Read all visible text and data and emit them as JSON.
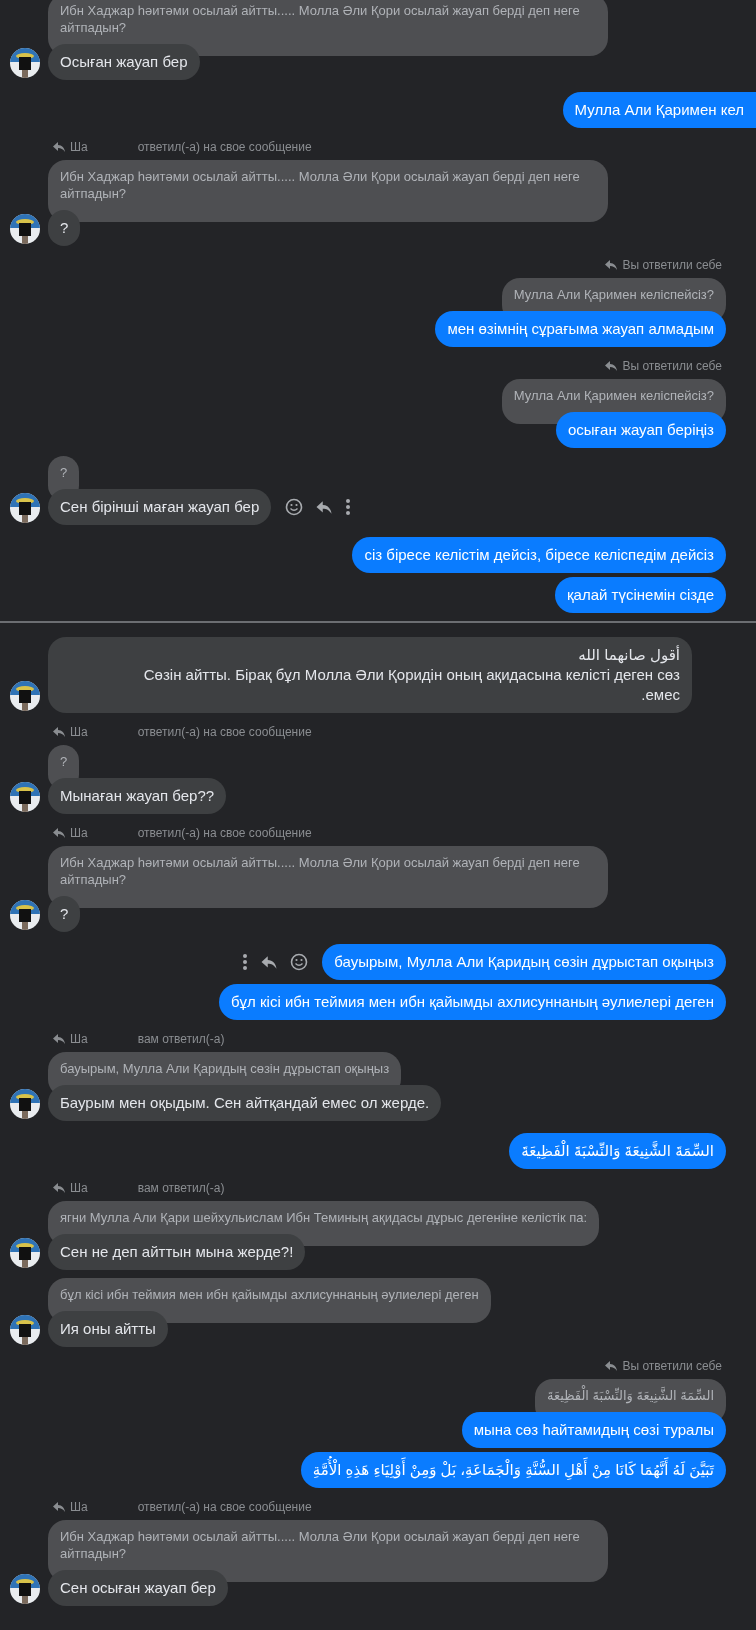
{
  "messages": [
    {
      "kind": "incoming",
      "quote": "Ибн Хаджар һәитәми осылай айтты..... Молла Әли Қори осылай жауап берді деп неге айтпадын?",
      "bubbles": [
        "Осыған жауап бер"
      ]
    },
    {
      "kind": "outgoing",
      "clipped": true,
      "bubbles": [
        "Мулла Али Қаримен кел"
      ]
    },
    {
      "kind": "incoming",
      "reply": {
        "name": "Ша",
        "text": "ответил(-а) на свое сообщение"
      },
      "quote": "Ибн Хаджар һәитәми осылай айтты..... Молла Әли Қори осылай жауап берді деп неге айтпадын?",
      "bubbles": [
        "?"
      ]
    },
    {
      "kind": "outgoing",
      "reply": {
        "text": "Вы ответили себе"
      },
      "quote": "Мулла Али Қаримен келіспейсіз?",
      "bubbles": [
        "мен өзімнің сұрағыма жауап алмадым"
      ]
    },
    {
      "kind": "outgoing",
      "reply": {
        "text": "Вы ответили себе"
      },
      "quote": "Мулла Али Қаримен келіспейсіз?",
      "bubbles": [
        "осыған жауап беріңіз"
      ]
    },
    {
      "kind": "incoming",
      "actions": true,
      "quote": "?",
      "bubbles": [
        "Сен бірінші маған жауап бер"
      ]
    },
    {
      "kind": "outgoing",
      "bubbles": [
        "сіз біресе келістім дейсіз, біресе келіспедім дейсіз",
        "қалай түсінемін сізде"
      ]
    },
    {
      "kind": "divider"
    },
    {
      "kind": "incoming",
      "bubbles": [
        "أقول صانهما الله\nСөзін айтты. Бірақ бұл Молла Әли Қоридін оның ақидасына келісті деген сөз\n.емес"
      ]
    },
    {
      "kind": "incoming",
      "reply": {
        "name": "Ша",
        "text": "ответил(-а) на свое сообщение"
      },
      "quote": "?",
      "bubbles": [
        "Мынаған жауап бер??"
      ]
    },
    {
      "kind": "incoming",
      "reply": {
        "name": "Ша",
        "text": "ответил(-а) на свое сообщение"
      },
      "quote": "Ибн Хаджар һәитәми осылай айтты..... Молла Әли Қори осылай жауап берді деп неге айтпадын?",
      "bubbles": [
        "?"
      ]
    },
    {
      "kind": "outgoing",
      "actions": true,
      "bubbles": [
        "бауырым, Мулла Али Қаридың сөзін дұрыстап оқыңыз",
        "бұл кісі ибн теймия мен ибн қайымды ахлисуннаның әулиелері деген"
      ]
    },
    {
      "kind": "incoming",
      "reply": {
        "name": "Ша",
        "text": "вам ответил(-а)"
      },
      "quote": "бауырым, Мулла Али Қаридың сөзін дұрыстап оқыңыз",
      "bubbles": [
        "Баурым мен оқыдым. Сен айтқандай емес ол жерде."
      ]
    },
    {
      "kind": "outgoing",
      "bubbles": [
        "السِّمَةَ الشَّنِيعَةَ وَالنِّسْبَةَ الْفَظِيعَةَ"
      ]
    },
    {
      "kind": "incoming",
      "reply": {
        "name": "Ша",
        "text": "вам ответил(-а)"
      },
      "quote": "ягни Мулла Али Қари шейхульислам Ибн Теминың ақидасы дұрыс дегеніне келістік па:",
      "bubbles": [
        "Сен не деп айттын мына жерде?!"
      ]
    },
    {
      "kind": "incoming",
      "quote": "бұл кісі ибн теймия мен ибн қайымды ахлисуннаның әулиелері деген",
      "bubbles": [
        "Ия оны айтты"
      ]
    },
    {
      "kind": "outgoing",
      "reply": {
        "text": "Вы ответили себе"
      },
      "quote": "السِّمَةَ الشَّنِيعَةَ وَالنِّسْبَةَ الْفَظِيعَةَ",
      "bubbles": [
        "мына сөз һайтамидың сөзі туралы",
        "تَبَيَّنَ لَهُ أَنَّهُمَا كَانَا مِنْ أَهْلِ السُّنَّةِ وَالْجَمَاعَةِ، بَلْ وَمِنْ أَوْلِيَاءِ هَذِهِ الْأُمَّةِ"
      ]
    },
    {
      "kind": "incoming",
      "reply": {
        "name": "Ша",
        "text": "ответил(-а) на свое сообщение"
      },
      "quote": "Ибн Хаджар һәитәми осылай айтты..... Молла Әли Қори осылай жауап берді деп неге айтпадын?",
      "bubbles": [
        "Сен осыған жауап бер"
      ]
    }
  ]
}
